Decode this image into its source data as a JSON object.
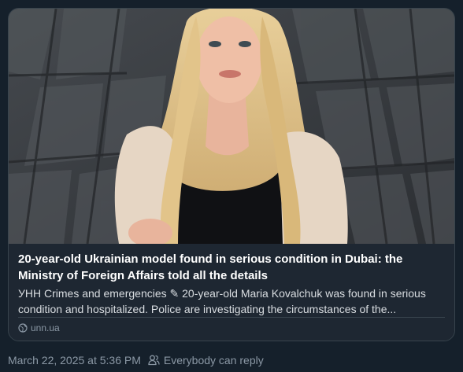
{
  "post": {
    "image_alt": "Photo of a young woman with long blonde hair in a beige blazer against a dark tiled wall",
    "headline": "20-year-old Ukrainian model found in serious condition in Dubai: the Ministry of Foreign Affairs told all the details",
    "summary": "УНН Crimes and emergencies ✎ 20-year-old Maria Kovalchuk was found in serious condition and hospitalized. Police are investigating the circumstances of the...",
    "source_icon": "globe-icon",
    "source": "unn.ua"
  },
  "meta": {
    "timestamp": "March 22, 2025 at 5:36 PM",
    "audience_icon": "people-icon",
    "audience": "Everybody can reply"
  },
  "colors": {
    "background": "#15202b",
    "card": "#1e2732",
    "border": "#38444d",
    "muted_text": "#8b98a5",
    "headline_text": "#ffffff"
  }
}
